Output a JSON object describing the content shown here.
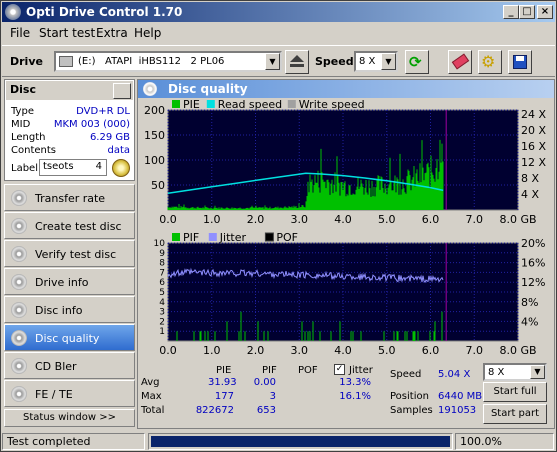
{
  "window": {
    "title": "Opti Drive Control 1.70",
    "min": "_",
    "max": "□",
    "close": "×"
  },
  "menu": [
    "File",
    "Start test",
    "Extra",
    "Help"
  ],
  "drivebar": {
    "drive_label": "Drive",
    "drive_value": "(E:)   ATAPI  iHBS112   2 PL06",
    "speed_label": "Speed",
    "speed_value": "8 X"
  },
  "disc": {
    "header": "Disc",
    "fields": [
      {
        "key": "Type",
        "value": "DVD+R DL"
      },
      {
        "key": "MID",
        "value": "MKM 003 (000)"
      },
      {
        "key": "Length",
        "value": "6.29 GB"
      },
      {
        "key": "Contents",
        "value": "data"
      }
    ],
    "label_key": "Label",
    "label_value": "tseots",
    "label_num": "4"
  },
  "nav": [
    "Transfer rate",
    "Create test disc",
    "Verify test disc",
    "Drive info",
    "Disc info",
    "Disc quality",
    "CD Bler",
    "FE / TE"
  ],
  "nav_active": 5,
  "status_window": "Status window >>",
  "panel": {
    "title": "Disc quality"
  },
  "chart_data": [
    {
      "type": "bar",
      "legend": [
        "PIE",
        "Read speed",
        "Write speed"
      ],
      "colors": {
        "PIE": "#00c000",
        "Read speed": "#00e0e0",
        "Write speed": "#a0a0a0"
      },
      "x_ticks": [
        "0.0",
        "1.0",
        "2.0",
        "3.0",
        "4.0",
        "5.0",
        "6.0",
        "7.0",
        "8.0 GB"
      ],
      "y_left_ticks": [
        "200",
        "150",
        "100",
        "50"
      ],
      "y_right_ticks": [
        "24 X",
        "20 X",
        "16 X",
        "12 X",
        "8 X",
        "4 X"
      ],
      "xlim": [
        0,
        8
      ],
      "ylim": [
        0,
        200
      ],
      "pie_profile": {
        "x": [
          0,
          0.5,
          1,
          1.5,
          2,
          2.5,
          3.0,
          3.15,
          3.2,
          3.5,
          4,
          4.5,
          5,
          5.5,
          6,
          6.29
        ],
        "y": [
          8,
          6,
          5,
          5,
          5,
          6,
          8,
          10,
          65,
          72,
          60,
          58,
          60,
          70,
          90,
          120
        ]
      },
      "read_speed": {
        "x": [
          0,
          0.5,
          1,
          1.5,
          2,
          2.5,
          3.15,
          3.5,
          4,
          4.5,
          5,
          5.5,
          6,
          6.29
        ],
        "y": [
          4.2,
          5.0,
          5.8,
          6.6,
          7.4,
          8.2,
          9.2,
          9.0,
          8.6,
          8.0,
          7.3,
          6.5,
          5.6,
          4.9
        ]
      }
    },
    {
      "type": "bar",
      "legend": [
        "PIF",
        "Jitter",
        "POF"
      ],
      "colors": {
        "PIF": "#00c000",
        "Jitter": "#9090ff",
        "POF": "#000000"
      },
      "x_ticks": [
        "0.0",
        "1.0",
        "2.0",
        "3.0",
        "4.0",
        "5.0",
        "6.0",
        "7.0",
        "8.0 GB"
      ],
      "y_left_ticks": [
        "10",
        "9",
        "8",
        "7",
        "6",
        "5",
        "4",
        "3",
        "2",
        "1"
      ],
      "y_right_ticks": [
        "20%",
        "16%",
        "12%",
        "8%",
        "4%"
      ],
      "xlim": [
        0,
        8
      ],
      "ylim": [
        0,
        10
      ],
      "jitter": {
        "x": [
          0,
          0.5,
          1,
          2,
          3,
          4,
          5,
          6,
          6.29
        ],
        "y": [
          13.6,
          14.0,
          13.9,
          13.8,
          13.5,
          13.2,
          12.9,
          12.6,
          12.5
        ]
      },
      "pif_max": 3
    }
  ],
  "stats": {
    "headers": [
      "PIE",
      "PIF",
      "POF"
    ],
    "jitter_label": "Jitter",
    "rows": [
      {
        "label": "Avg",
        "pie": "31.93",
        "pif": "0.00",
        "pof": "",
        "jitter": "13.3%"
      },
      {
        "label": "Max",
        "pie": "177",
        "pif": "3",
        "pof": "",
        "jitter": "16.1%"
      },
      {
        "label": "Total",
        "pie": "822672",
        "pif": "653",
        "pof": "",
        "jitter": ""
      }
    ],
    "speed_label": "Speed",
    "speed_value": "5.04 X",
    "position_label": "Position",
    "position_value": "6440 MB",
    "samples_label": "Samples",
    "samples_value": "191053",
    "speed_select": "8 X",
    "start_full": "Start full",
    "start_part": "Start part"
  },
  "statusbar": {
    "text": "Test completed",
    "progress": 1.0,
    "percent": "100.0%"
  }
}
